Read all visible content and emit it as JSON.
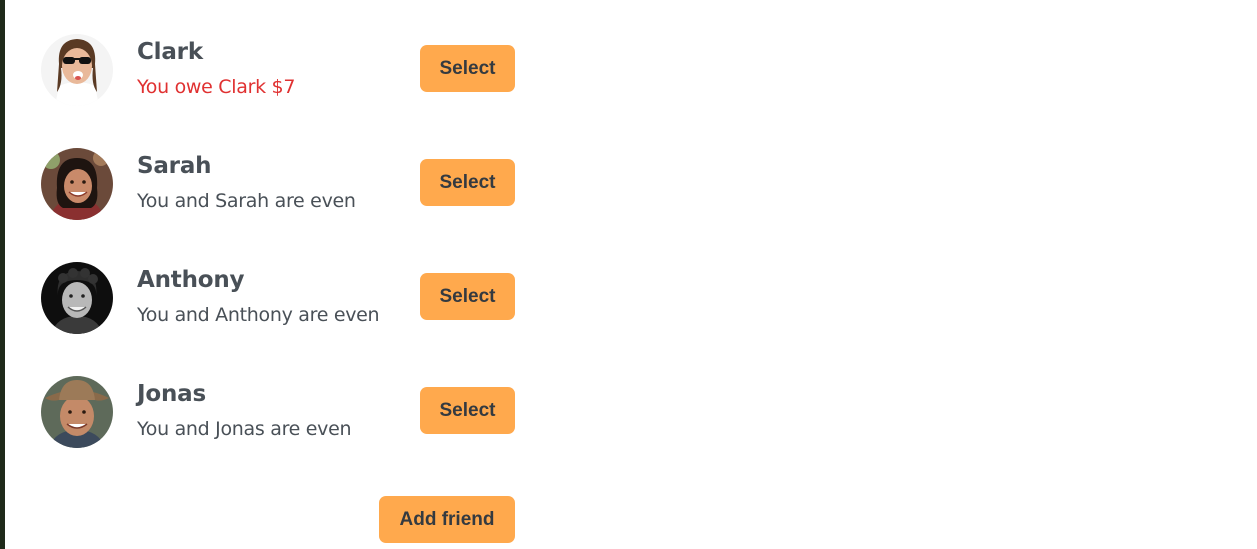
{
  "friends": [
    {
      "name": "Clark",
      "status": "You owe Clark $7",
      "status_type": "owe",
      "select_label": "Select",
      "avatar_icon": "avatar-clark"
    },
    {
      "name": "Sarah",
      "status": "You and Sarah are even",
      "status_type": "even",
      "select_label": "Select",
      "avatar_icon": "avatar-sarah"
    },
    {
      "name": "Anthony",
      "status": "You and Anthony are even",
      "status_type": "even",
      "select_label": "Select",
      "avatar_icon": "avatar-anthony"
    },
    {
      "name": "Jonas",
      "status": "You and Jonas are even",
      "status_type": "even",
      "select_label": "Select",
      "avatar_icon": "avatar-jonas"
    }
  ],
  "add_friend_label": "Add friend",
  "colors": {
    "accent": "#ffa94d",
    "owe": "#e03131",
    "text": "#495057"
  }
}
